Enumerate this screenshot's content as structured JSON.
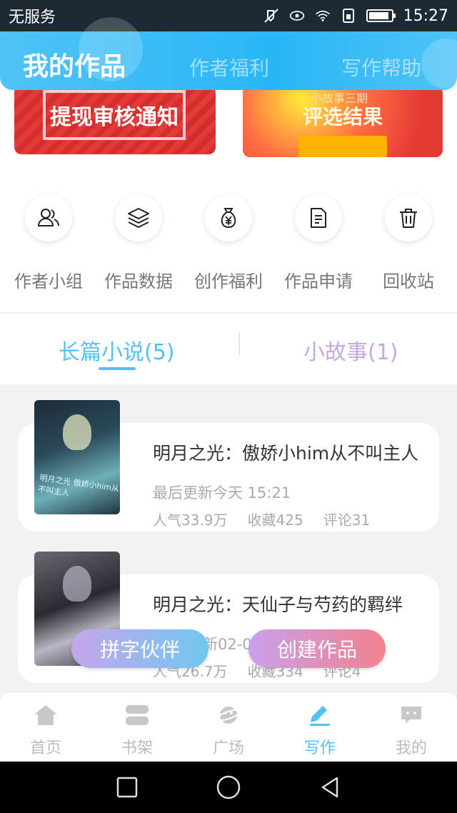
{
  "status_bar": {
    "carrier": "无服务",
    "time": "15:27",
    "icons": [
      "mute-icon",
      "eye-icon",
      "wifi-icon",
      "sim-icon",
      "battery-icon"
    ]
  },
  "header": {
    "tabs": [
      {
        "label": "我的作品",
        "active": true
      },
      {
        "label": "作者福利",
        "active": false
      },
      {
        "label": "写作帮助",
        "active": false
      }
    ],
    "accent": "#4fc3f7"
  },
  "banners": [
    {
      "text": "提现审核通知"
    },
    {
      "small": "小故事三期",
      "text": "评选结果"
    }
  ],
  "quick_actions": [
    {
      "label": "作者小组",
      "icon": "group-icon"
    },
    {
      "label": "作品数据",
      "icon": "layers-icon"
    },
    {
      "label": "创作福利",
      "icon": "money-bag-icon"
    },
    {
      "label": "作品申请",
      "icon": "document-icon"
    },
    {
      "label": "回收站",
      "icon": "trash-icon"
    }
  ],
  "segments": [
    {
      "label": "长篇小说(5)",
      "active": true
    },
    {
      "label": "小故事(1)",
      "active": false
    }
  ],
  "works": [
    {
      "title": "明月之光：傲娇小him从不叫主人",
      "updated": "最后更新今天 15:21",
      "popularity": "人气33.9万",
      "favorites": "收藏425",
      "comments": "评论31",
      "cover_text": "明月之光 傲娇小him从不叫主人"
    },
    {
      "title": "明月之光：天仙子与芍药的羁绊",
      "updated": "新02-0",
      "popularity": "人气26.7万",
      "favorites": "收藏334",
      "comments": "评论4"
    }
  ],
  "fab": {
    "left": "拼字伙伴",
    "right": "创建作品"
  },
  "bottom_nav": [
    {
      "label": "首页",
      "icon": "home-icon",
      "active": false
    },
    {
      "label": "书架",
      "icon": "bookshelf-icon",
      "active": false
    },
    {
      "label": "广场",
      "icon": "planet-icon",
      "active": false
    },
    {
      "label": "写作",
      "icon": "pen-icon",
      "active": true
    },
    {
      "label": "我的",
      "icon": "chat-face-icon",
      "active": false
    }
  ],
  "system_nav": [
    "recent-apps-icon",
    "home-circle-icon",
    "back-icon"
  ]
}
